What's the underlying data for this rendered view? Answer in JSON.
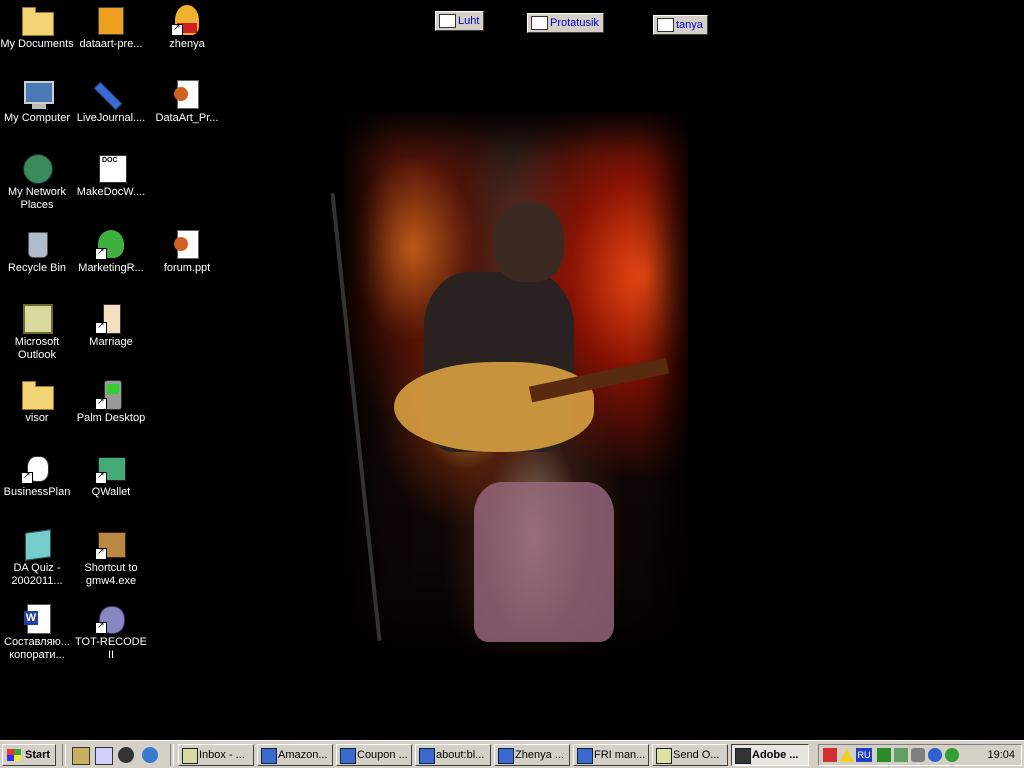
{
  "desktop": {
    "icons": [
      {
        "label": "My Documents"
      },
      {
        "label": "dataart-pre..."
      },
      {
        "label": "zhenya"
      },
      {
        "label": "My Computer"
      },
      {
        "label": "LiveJournal...."
      },
      {
        "label": "DataArt_Pr..."
      },
      {
        "label": "My Network Places"
      },
      {
        "label": "MakeDocW...."
      },
      {
        "label": "Recycle Bin"
      },
      {
        "label": "MarketingR..."
      },
      {
        "label": "forum.ppt"
      },
      {
        "label": "Microsoft Outlook"
      },
      {
        "label": "Marriage"
      },
      {
        "label": "visor"
      },
      {
        "label": "Palm Desktop"
      },
      {
        "label": "BusinessPlan"
      },
      {
        "label": "QWallet"
      },
      {
        "label": "DA Quiz - 2002011..."
      },
      {
        "label": "Shortcut to gmw4.exe"
      },
      {
        "label": "Составляю... копорати..."
      },
      {
        "label": "TOT-RECODE II"
      }
    ],
    "floating_windows": [
      {
        "label": "Luht"
      },
      {
        "label": "Protatusik"
      },
      {
        "label": "tanya"
      }
    ]
  },
  "taskbar": {
    "start_label": "Start",
    "tasks": [
      {
        "label": "Inbox - ..."
      },
      {
        "label": "Amazon..."
      },
      {
        "label": "Coupon ..."
      },
      {
        "label": "about:bl..."
      },
      {
        "label": "Zhenya ..."
      },
      {
        "label": "FRI man..."
      },
      {
        "label": "Send O..."
      },
      {
        "label": "Adobe ..."
      }
    ],
    "tray": {
      "language": "RU",
      "clock": "19:04"
    }
  }
}
